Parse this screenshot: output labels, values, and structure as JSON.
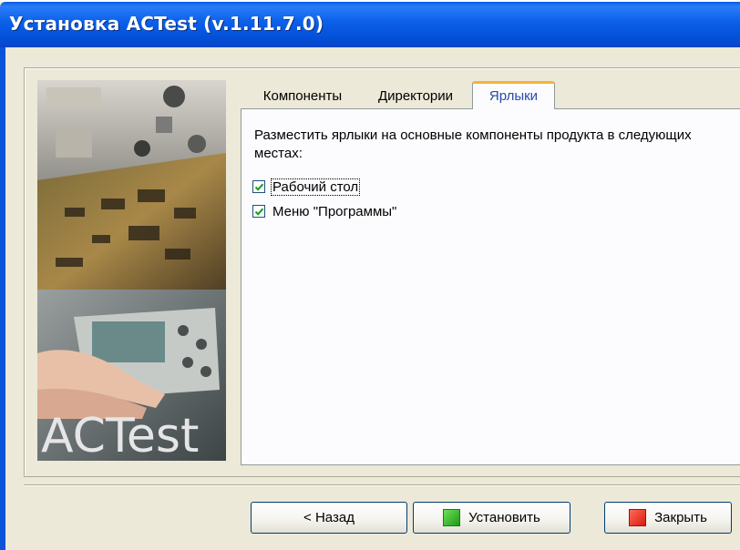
{
  "window": {
    "title": "Установка ACTest (v.1.11.7.0)"
  },
  "side_image": {
    "brand_text": "ACTest"
  },
  "tabs": [
    {
      "label": "Компоненты",
      "active": false
    },
    {
      "label": "Директории",
      "active": false
    },
    {
      "label": "Ярлыки",
      "active": true
    }
  ],
  "shortcuts_panel": {
    "description": "Разместить ярлыки на основные компоненты продукта в следующих местах:",
    "options": [
      {
        "label": "Рабочий стол",
        "checked": true,
        "focused": true
      },
      {
        "label": "Меню \"Программы\"",
        "checked": true,
        "focused": false
      }
    ]
  },
  "buttons": {
    "back": "< Назад",
    "install": "Установить",
    "close": "Закрыть"
  },
  "colors": {
    "titlebar": "#0b5fe8",
    "dialog_background": "#ece9d8",
    "active_tab_text": "#2b49a8",
    "active_tab_highlight": "#f5b23a",
    "checkmark": "#21a121"
  },
  "icons": {
    "install_button_icon": "green-square-icon",
    "close_button_icon": "red-square-icon"
  }
}
